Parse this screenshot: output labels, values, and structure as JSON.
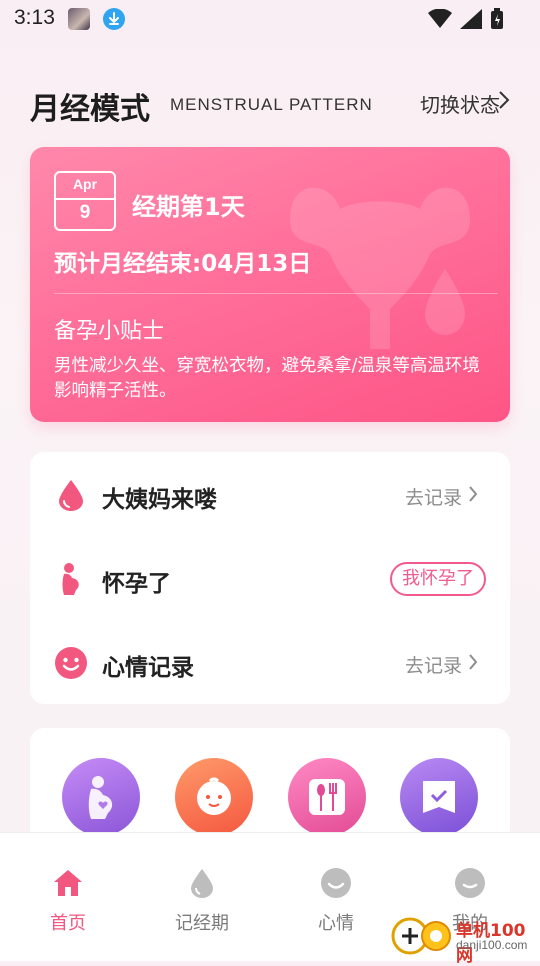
{
  "status_bar": {
    "time": "3:13"
  },
  "header": {
    "title": "月经模式",
    "subtitle": "MENSTRUAL PATTERN",
    "switch_label": "切换状态"
  },
  "period_card": {
    "month": "Apr",
    "day": "9",
    "period_day": "经期第1天",
    "expected_end": "预计月经结束:04月13日",
    "tips_title": "备孕小贴士",
    "tips_text": "男性减少久坐、穿宽松衣物，避免桑拿/温泉等高温环境影响精子活性。"
  },
  "records": [
    {
      "label": "大姨妈来喽",
      "action": "去记录",
      "icon": "drop-icon"
    },
    {
      "label": "怀孕了",
      "action": "我怀孕了",
      "icon": "pregnant-icon"
    },
    {
      "label": "心情记录",
      "action": "去记录",
      "icon": "smile-icon"
    }
  ],
  "tools": [
    {
      "icon": "pregnancy-heart-icon",
      "color": "#a36be0"
    },
    {
      "icon": "baby-face-icon",
      "color": "#f6714f"
    },
    {
      "icon": "diet-icon",
      "color": "#ef5aa0"
    },
    {
      "icon": "checklist-icon",
      "color": "#8f62dc"
    }
  ],
  "bottom_nav": [
    {
      "label": "首页",
      "icon": "home-icon",
      "active": true
    },
    {
      "label": "记经期",
      "icon": "drop-icon",
      "active": false
    },
    {
      "label": "心情",
      "icon": "smile-icon",
      "active": false
    },
    {
      "label": "我的",
      "icon": "profile-icon",
      "active": false
    }
  ],
  "watermark": {
    "line1": "单机100网",
    "line2": "danji100.com"
  },
  "colors": {
    "accent": "#f2587f",
    "card_start": "#ff88ab",
    "card_end": "#fd5586"
  }
}
